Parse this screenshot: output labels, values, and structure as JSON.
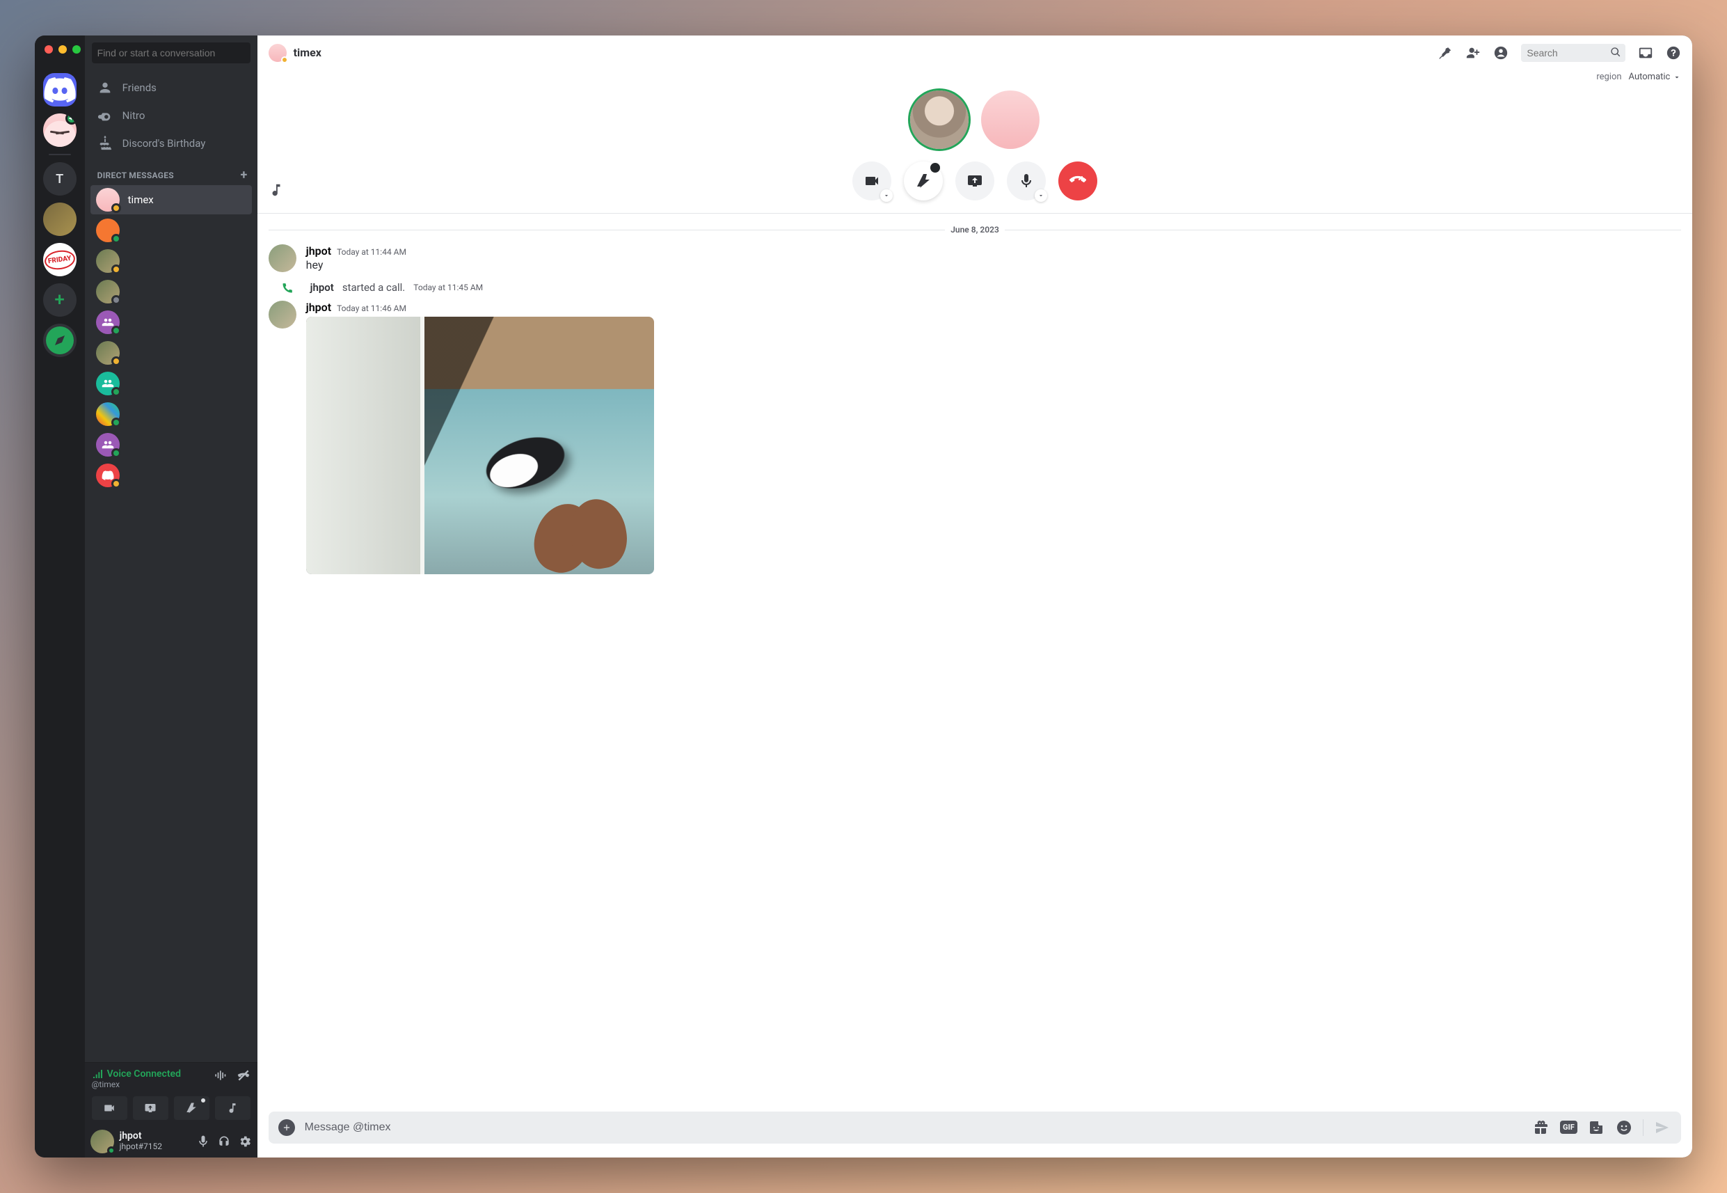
{
  "window": {
    "search_placeholder": "Find or start a conversation"
  },
  "rail": {
    "home_aria": "Home",
    "servers": [
      {
        "id": "pink",
        "kind": "avatar-pink",
        "badge": "speaker"
      },
      {
        "id": "t",
        "kind": "letter",
        "label": "T"
      },
      {
        "id": "img1",
        "kind": "img"
      },
      {
        "id": "friday",
        "kind": "friday",
        "label": "FRIDAY"
      }
    ],
    "add_label": "+",
    "explore_aria": "Explore"
  },
  "nav": {
    "friends": "Friends",
    "nitro": "Nitro",
    "birthday": "Discord's Birthday"
  },
  "dm_header": "DIRECT MESSAGES",
  "dm_items": [
    {
      "name": "timex",
      "color": "pink",
      "status": "idle",
      "active": true
    },
    {
      "name": "",
      "color": "orange",
      "status": "on"
    },
    {
      "name": "",
      "color": "img",
      "status": "idle"
    },
    {
      "name": "",
      "color": "img",
      "status": "off"
    },
    {
      "name": "",
      "color": "purple",
      "status": "on",
      "group": true
    },
    {
      "name": "",
      "color": "img",
      "status": "idle"
    },
    {
      "name": "",
      "color": "teal",
      "status": "on",
      "group": true
    },
    {
      "name": "",
      "color": "multi",
      "status": "on"
    },
    {
      "name": "",
      "color": "purple",
      "status": "on",
      "group": true
    },
    {
      "name": "",
      "color": "red",
      "status": "idle"
    }
  ],
  "voice": {
    "status": "Voice Connected",
    "channel": "@timex"
  },
  "user": {
    "name": "jhpot",
    "tag": "jhpot#7152"
  },
  "topbar": {
    "title": "timex",
    "search_placeholder": "Search",
    "region_label": "region",
    "region_value": "Automatic"
  },
  "call": {
    "participants": 2
  },
  "divider_date": "June 8, 2023",
  "messages": [
    {
      "type": "msg",
      "author": "jhpot",
      "time": "Today at 11:44 AM",
      "text": "hey"
    },
    {
      "type": "sys",
      "author": "jhpot",
      "desc": "started a call.",
      "time": "Today at 11:45 AM"
    },
    {
      "type": "msg",
      "author": "jhpot",
      "time": "Today at 11:46 AM",
      "text": "",
      "attachment": "cat-photo"
    }
  ],
  "composer": {
    "placeholder": "Message @timex",
    "gif_label": "GIF"
  }
}
